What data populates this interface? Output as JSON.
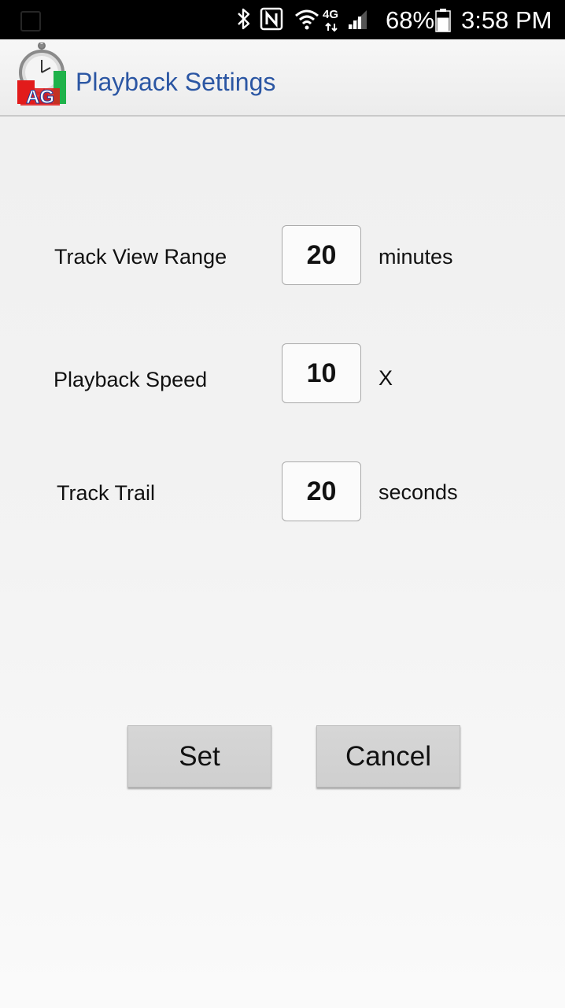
{
  "status_bar": {
    "icons": [
      "bluetooth-icon",
      "nfc-icon",
      "wifi-icon",
      "lte-4g-icon",
      "signal-icon"
    ],
    "lte_label": "4G",
    "battery_percent": "68%",
    "battery_level": 0.68,
    "time": "3:58 PM"
  },
  "app_bar": {
    "title": "Playback Settings",
    "logo_text": "AG",
    "logo_colors": {
      "red": "#e21b1b",
      "green": "#1fb24a",
      "blue": "#1e3f9c"
    }
  },
  "settings": [
    {
      "label": "Track View Range",
      "value": "20",
      "unit": "minutes"
    },
    {
      "label": "Playback Speed",
      "value": "10",
      "unit": "X"
    },
    {
      "label": "Track Trail",
      "value": "20",
      "unit": "seconds"
    }
  ],
  "buttons": {
    "set_label": "Set",
    "cancel_label": "Cancel"
  },
  "colors": {
    "title": "#2b56a3",
    "status_bar_bg": "#000000",
    "button_bg": "#d3d3d3"
  }
}
